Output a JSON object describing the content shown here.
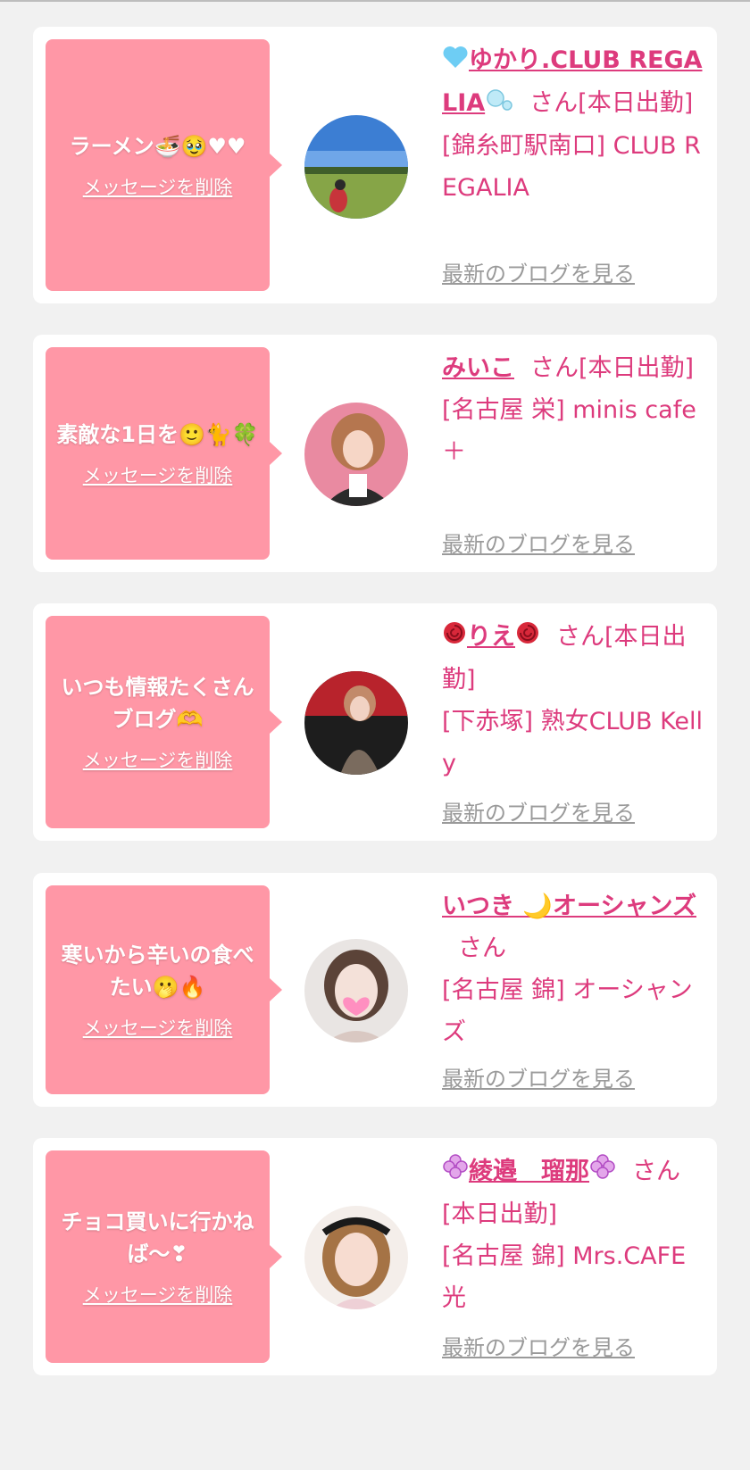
{
  "common": {
    "delete_label": "メッセージを削除",
    "blog_label": "最新のブログを見る",
    "san_label": "さん"
  },
  "colors": {
    "page_bg": "#f1f1f1",
    "bubble_pink": "#ff97a6",
    "name_pink": "#dd3b7d",
    "link_gray": "#9a9a9a"
  },
  "entries": [
    {
      "message": "ラーメン🍜🥹♥♥",
      "name_prefix_icon": "blue-heart-icon",
      "name": "ゆかり.CLUB REGALIA",
      "name_suffix_icon": "bubbles-icon",
      "status": "[本日出勤]",
      "shop": "[錦糸町駅南口] CLUB REGALIA",
      "avatar": "golf-course-photo"
    },
    {
      "message": "素敵な1日を🙂🐈🍀",
      "name": "みいこ",
      "status": "[本日出勤]",
      "shop": "[名古屋 栄] minis cafe ＋",
      "avatar": "woman-pink-background-photo"
    },
    {
      "message": "いつも情報たくさんブログ🫶",
      "name_prefix_icon": "rose-icon",
      "name": "りえ",
      "name_suffix_icon": "rose-icon",
      "status": "[本日出勤]",
      "shop": "[下赤塚] 熟女CLUB Kelly",
      "avatar": "woman-red-background-photo"
    },
    {
      "message": "寒いから辛いの食べたい🫢🔥",
      "name": "いつき 🌙オーシャンズ",
      "status": "",
      "shop": "[名古屋 錦] オーシャンズ",
      "avatar": "woman-heart-sticker-photo"
    },
    {
      "message": "チョコ買いに行かねば〜❣",
      "name_prefix_icon": "purple-clover-icon",
      "name": "綾邉　瑠那",
      "name_suffix_icon": "purple-clover-icon",
      "status": "[本日出勤]",
      "shop": "[名古屋 錦] Mrs.CAFE 光",
      "avatar": "woman-headband-photo"
    }
  ]
}
